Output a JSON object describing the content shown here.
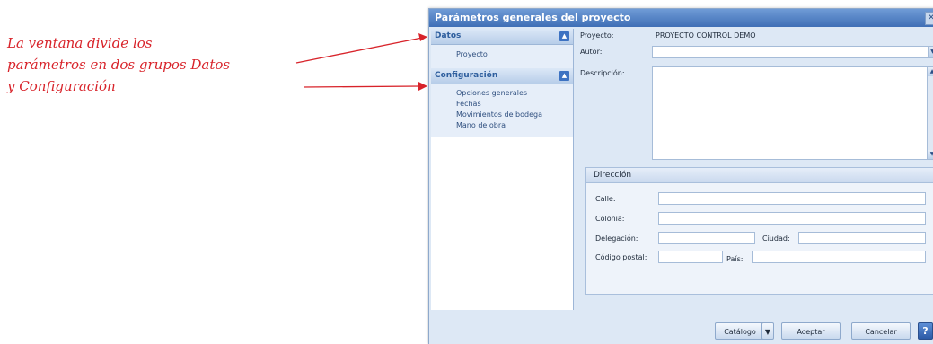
{
  "annotation": {
    "lines": [
      "La ventana divide los",
      "parámetros en dos grupos Datos",
      "y Configuración"
    ]
  },
  "window": {
    "title": "Parámetros generales del proyecto",
    "close_icon": "close-icon"
  },
  "nav": {
    "group1": {
      "title": "Datos",
      "items": [
        "Proyecto"
      ]
    },
    "group2": {
      "title": "Configuración",
      "items": [
        "Opciones generales",
        "Fechas",
        "Movimientos de bodega",
        "Mano de obra"
      ]
    }
  },
  "form": {
    "proyecto_label": "Proyecto:",
    "proyecto_value": "PROYECTO CONTROL DEMO",
    "autor_label": "Autor:",
    "autor_value": "",
    "descripcion_label": "Descripción:",
    "direccion": {
      "title": "Dirección",
      "calle_label": "Calle:",
      "colonia_label": "Colonia:",
      "delegacion_label": "Delegación:",
      "ciudad_label": "Ciudad:",
      "cp_label": "Código postal:",
      "pais_label": "País:"
    }
  },
  "footer": {
    "catalogo": "Catálogo",
    "aceptar": "Aceptar",
    "cancelar": "Cancelar",
    "help": "?"
  },
  "colors": {
    "annotation": "#d8232a",
    "titlebar": "#4f7fc4",
    "panel": "#dde8f5"
  }
}
